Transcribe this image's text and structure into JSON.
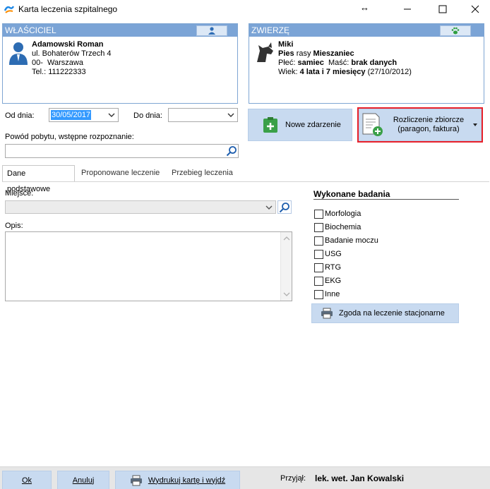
{
  "window": {
    "title": "Karta leczenia szpitalnego",
    "resize_glyph": "↔"
  },
  "owner_panel": {
    "header": "WŁAŚCICIEL",
    "name": "Adamowski Roman",
    "street": "ul. Bohaterów Trzech 4",
    "city": "00-  Warszawa",
    "phone": "Tel.: 111222333",
    "icon": "person-icon"
  },
  "pet_panel": {
    "header": "ZWIERZĘ",
    "name": "Miki",
    "species_prefix": "Pies",
    "breed_prefix": " rasy ",
    "breed": "Mieszaniec",
    "sex_label": "Płeć: ",
    "sex": "samiec",
    "coat_label": "  Maść: ",
    "coat": "brak danych",
    "age_label": "Wiek: ",
    "age": "4 lata i 7 miesięcy",
    "birth": " (27/10/2012)",
    "icon": "dog-icon"
  },
  "dates": {
    "from_label": "Od dnia:",
    "from_value": "30/05/2017",
    "to_label": "Do dnia:",
    "to_value": ""
  },
  "reason": {
    "label": "Powód pobytu, wstępne rozpoznanie:",
    "value": ""
  },
  "actions": {
    "new_event": "Nowe zdarzenie",
    "settlement_line1": "Rozliczenie zbiorcze",
    "settlement_line2": "(paragon, faktura)"
  },
  "tabs": [
    {
      "label": "Dane podstawowe",
      "active": true
    },
    {
      "label": "Proponowane leczenie",
      "active": false
    },
    {
      "label": "Przebieg leczenia",
      "active": false
    }
  ],
  "form": {
    "place_label": "Miejsce:",
    "place_value": "",
    "desc_label": "Opis:",
    "desc_value": ""
  },
  "tests": {
    "title": "Wykonane badania",
    "items": [
      "Morfologia",
      "Biochemia",
      "Badanie moczu",
      "USG",
      "RTG",
      "EKG",
      "Inne"
    ],
    "consent_button": "Zgoda na leczenie stacjonarne"
  },
  "bottom": {
    "ok": "Ok",
    "cancel": "Anuluj",
    "print": "Wydrukuj kartę i wyjdź",
    "received_label": "Przyjął:",
    "received_by": "lek. wet. Jan Kowalski"
  },
  "colors": {
    "panel_header": "#7ba4d6",
    "button_bg": "#c8daf0",
    "highlight_frame": "#e8202a",
    "selection": "#3399ff"
  }
}
